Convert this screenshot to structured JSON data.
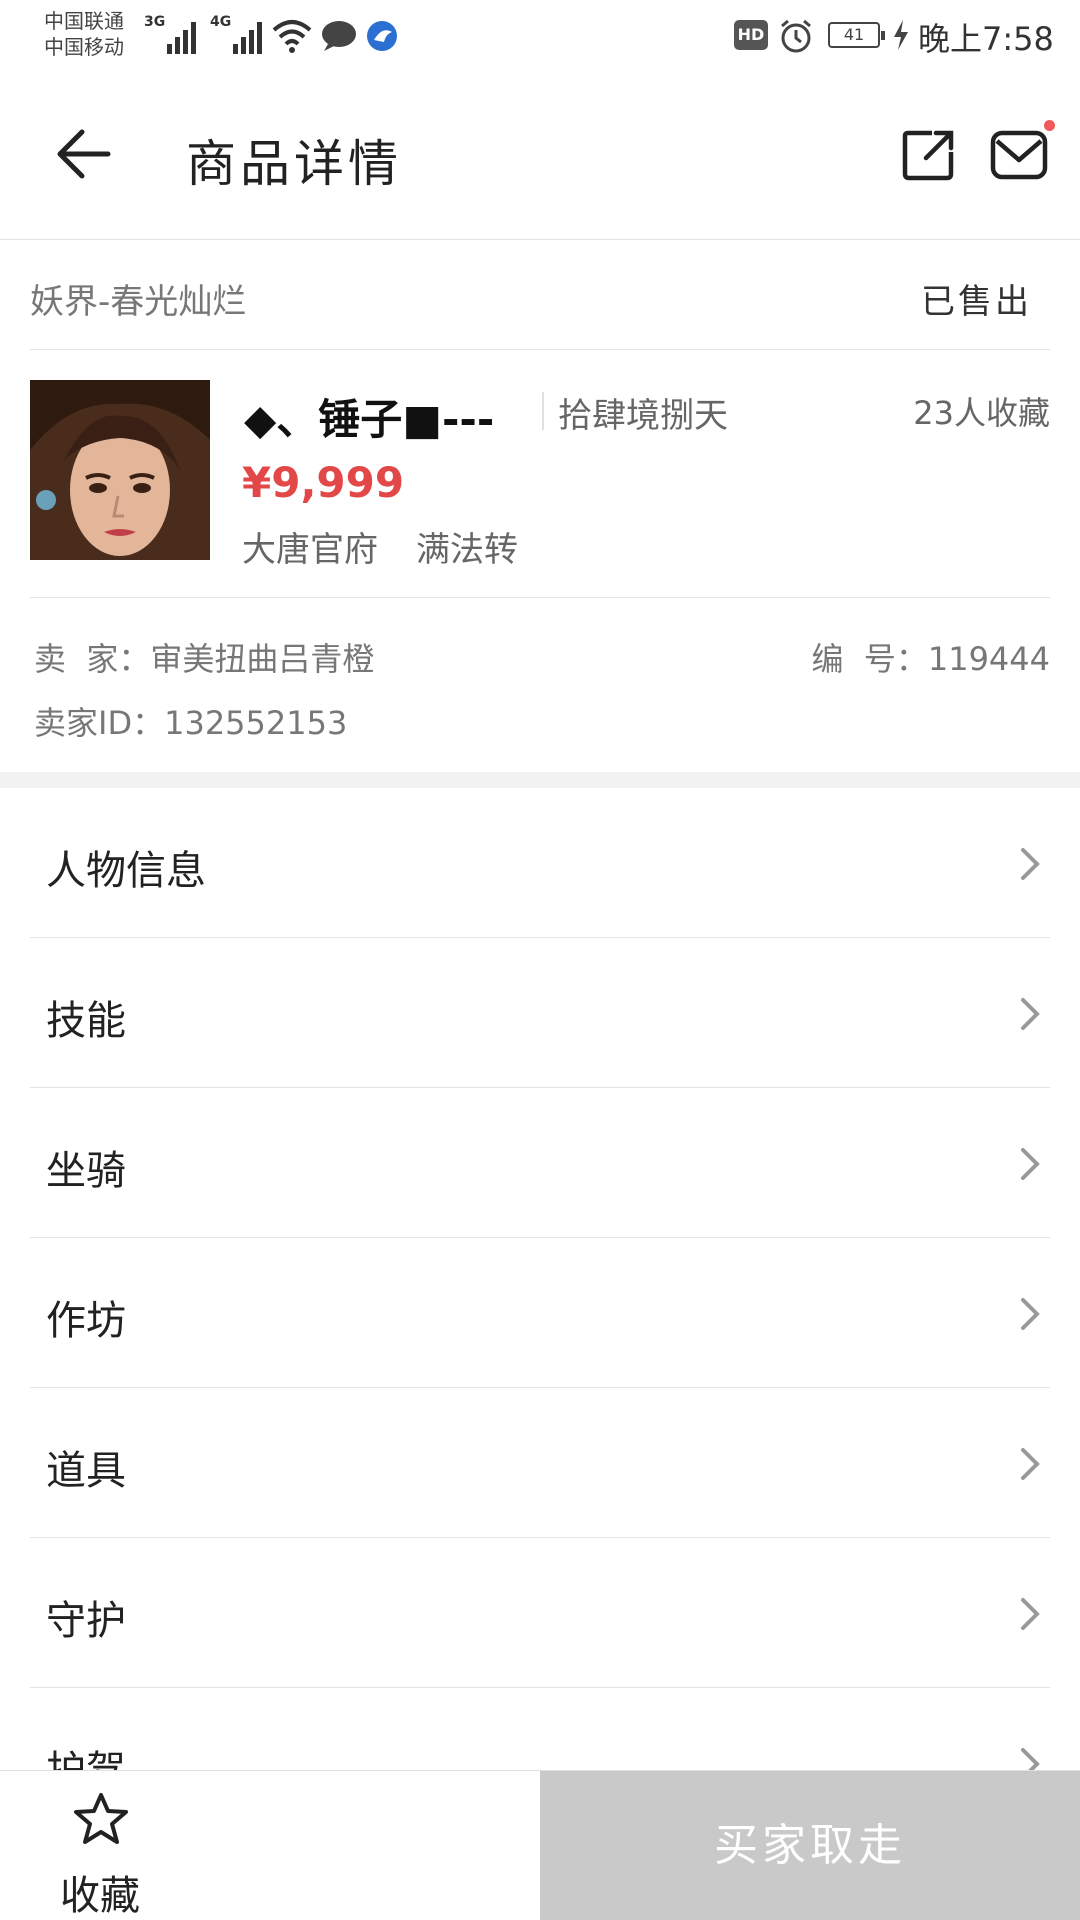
{
  "status_bar": {
    "carrier_1": "中国联通",
    "carrier_2": "中国移动",
    "network_1": "3G",
    "network_2": "4G",
    "hd": "HD",
    "battery": "41",
    "time": "晚上7:58"
  },
  "header": {
    "title": "商品详情"
  },
  "server": {
    "name": "妖界-春光灿烂",
    "status": "已售出"
  },
  "item": {
    "name": "◆、锤子■---",
    "level": "拾肆境捌天",
    "favorites": "23人收藏",
    "price": "¥9,999",
    "faction": "大唐官府",
    "tag": "满法转"
  },
  "seller": {
    "seller_label": "卖  家：",
    "seller_name": "审美扭曲吕青橙",
    "id_label": "卖家ID：",
    "id_value": "132552153",
    "code_label": "编  号：",
    "code_value": "119444"
  },
  "menu": {
    "items": [
      {
        "label": "人物信息"
      },
      {
        "label": "技能"
      },
      {
        "label": "坐骑"
      },
      {
        "label": "作坊"
      },
      {
        "label": "道具"
      },
      {
        "label": "守护"
      },
      {
        "label": "护驾"
      }
    ]
  },
  "bottom": {
    "favorite_label": "收藏",
    "buy_label": "买家取走"
  },
  "colors": {
    "price": "#e24848",
    "buy_button_disabled": "#c9c9c9",
    "notification_dot": "#f25a5a"
  },
  "icons": {
    "back": "arrow-left-icon",
    "share": "share-external-icon",
    "mail": "mail-icon",
    "chevron": "chevron-right-icon",
    "favorite": "star-outline-icon"
  }
}
